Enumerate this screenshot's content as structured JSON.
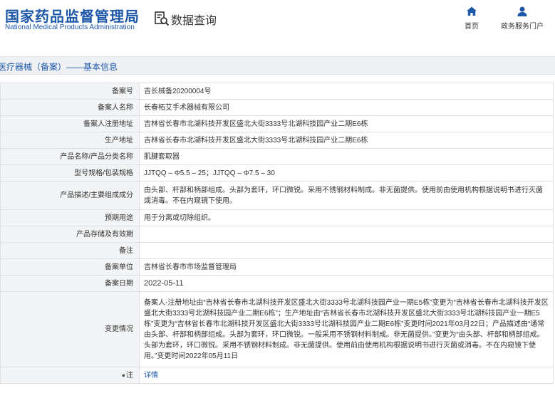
{
  "header": {
    "logo_cn": "国家药品监督管理局",
    "logo_en": "National Medical Products Administration",
    "search_title": "数据查询",
    "search_icon": "search-document-icon",
    "nav": [
      {
        "label": "首页",
        "icon": "home-icon"
      },
      {
        "label": "政务服务门户",
        "icon": "user-icon"
      }
    ]
  },
  "page": {
    "title": "医疗器械（备案）——基本信息"
  },
  "colors": {
    "brand_blue": "#1d57a8",
    "label_bg": "#f3f4f6",
    "title_bar_bg": "#eef0f4"
  },
  "rows": [
    {
      "label": "备案号",
      "value": "吉长械备20200004号"
    },
    {
      "label": "备案人名称",
      "value": "长春柘艾手术器械有限公司"
    },
    {
      "label": "备案人注册地址",
      "value": "吉林省长春市北湖科技开发区盛北大街3333号北湖科技园产业二期E6栋"
    },
    {
      "label": "生产地址",
      "value": "吉林省长春市北湖科技开发区盛北大街3333号北湖科技园产业二期E6栋"
    },
    {
      "label": "产品名称/产品分类名称",
      "value": "肌腱套取器"
    },
    {
      "label": "型号规格/包装规格",
      "value": "JJTQQ – Φ5.5 – 25；JJTQQ – Φ7.5 – 30"
    },
    {
      "label": "产品描述/主要组成成分",
      "value": "由头部、杆部和柄部组成。头部为套环，环口微锐。采用不锈钢材料制成。非无菌提供。使用前由使用机构根据说明书进行灭菌或消毒。不在内窥镜下使用。"
    },
    {
      "label": "预期用途",
      "value": "用于分离或切除组织。"
    },
    {
      "label": "产品存储及有效期",
      "value": ""
    },
    {
      "label": "备注",
      "value": ""
    },
    {
      "label": "备案单位",
      "value": "吉林省长春市市场监督管理局"
    },
    {
      "label": "备案日期",
      "value": "2022-05-11"
    },
    {
      "label": "变更情况",
      "value": "备案人-注册地址由“吉林省长春市北湖科技开发区盛北大街3333号北湖科技园产业一期E5栋”变更为“吉林省长春市北湖科技开发区盛北大街3333号北湖科技园产业二期E6栋”；生产地址由“吉林省长春市北湖科技开发区盛北大街3333号北湖科技园产业一期E5栋”变更为“吉林省长春市北湖科技开发区盛北大街3333号北湖科技园产业二期E6栋”变更时间2021年03月22日；产品描述由“通常由头部、杆部和柄部组成。头部为套环，环口微锐。一般采用不锈钢材料制成。非无菌提供。”变更为“由头部、杆部和柄部组成。头部为套环，环口微锐。采用不锈钢材料制成。非无菌提供。使用前由使用机构根据说明书进行灭菌或消毒。不在内窥镜下使用。”变更时间2022年05月11日"
    },
    {
      "label": "注",
      "label_icon": "●",
      "value": "详情"
    }
  ]
}
